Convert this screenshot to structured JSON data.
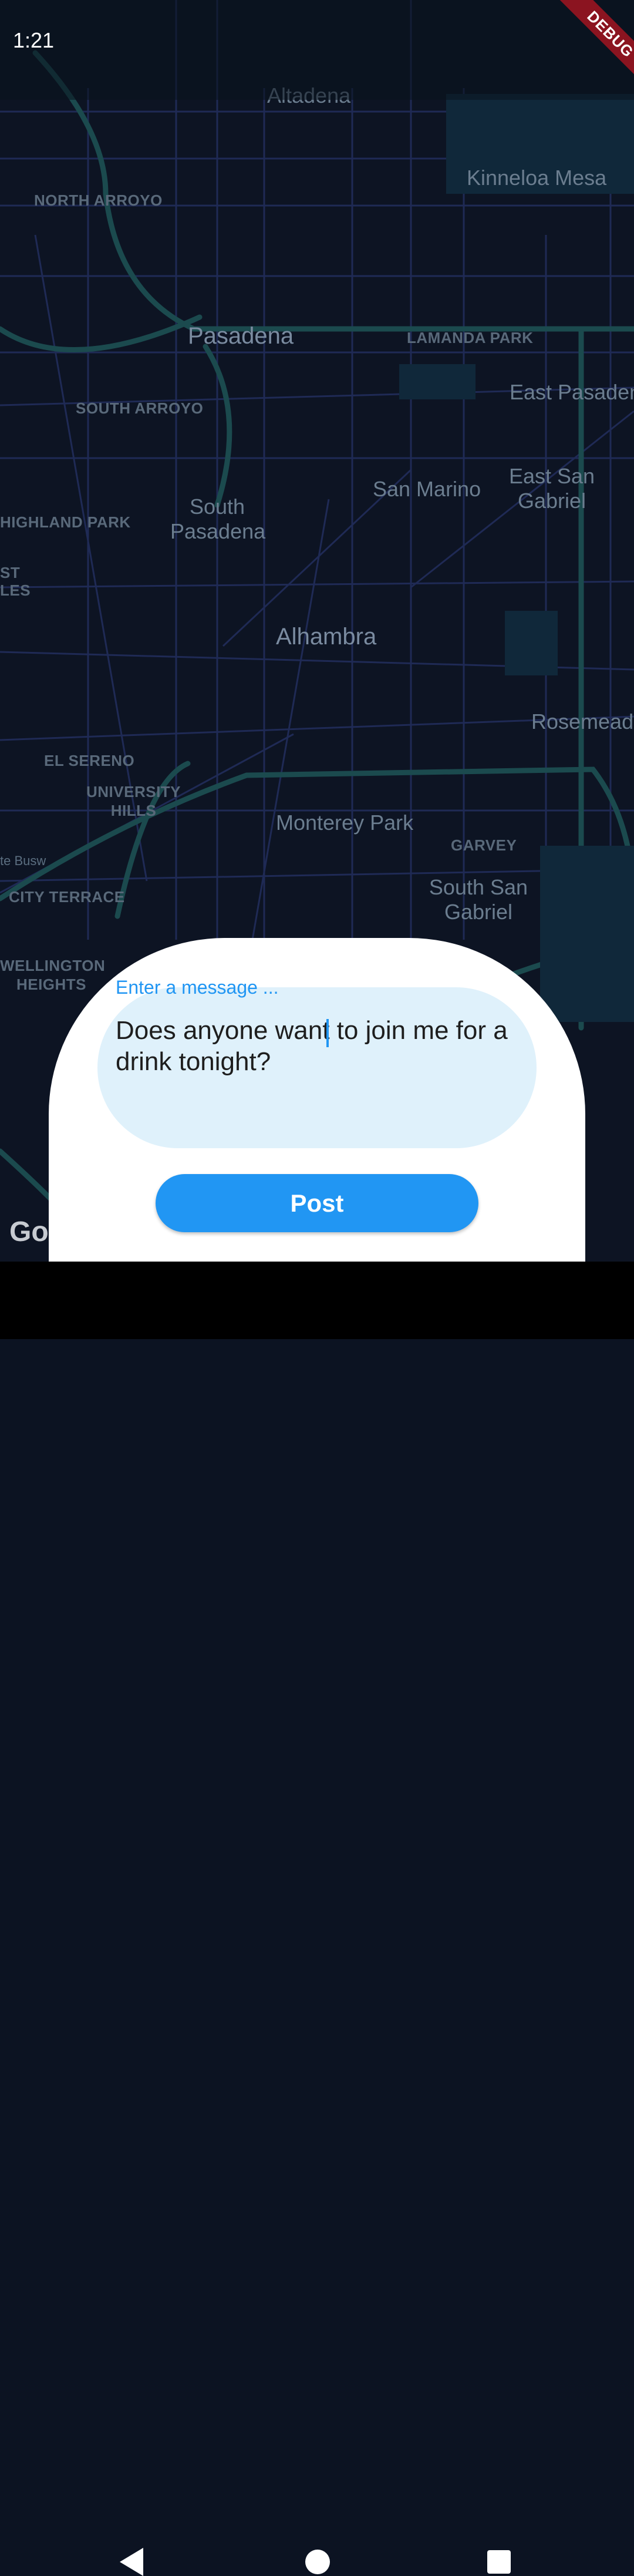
{
  "status_bar": {
    "time": "1:21"
  },
  "debug_banner": "DEBUG",
  "map": {
    "labels": {
      "altadena": "Altadena",
      "kinneloa_mesa": "Kinneloa Mesa",
      "north_arroyo": "NORTH ARROYO",
      "pasadena": "Pasadena",
      "lamanda_park": "LAMANDA PARK",
      "east_pasadena": "East Pasaden",
      "south_arroyo": "SOUTH ARROYO",
      "south_pasadena_1": "South",
      "south_pasadena_2": "Pasadena",
      "san_marino": "San Marino",
      "east_san_gabriel_1": "East San",
      "east_san_gabriel_2": "Gabriel",
      "highland_park": "HIGHLAND PARK",
      "east_la_1": "ST",
      "east_la_2": "LES",
      "alhambra": "Alhambra",
      "rosemead": "Rosemead",
      "el_sereno": "EL SERENO",
      "university_hills_1": "UNIVERSITY",
      "university_hills_2": "HILLS",
      "monterey_park": "Monterey Park",
      "garvey": "GARVEY",
      "busway": "te Busw",
      "city_terrace": "CITY TERRACE",
      "south_san_gabriel_1": "South San",
      "south_san_gabriel_2": "Gabriel",
      "wellington_heights_1": "WELLINGTON",
      "wellington_heights_2": "HEIGHTS"
    },
    "google_logo": "Go"
  },
  "compose": {
    "field_label": "Enter a message ...",
    "message_value": "Does anyone want to join me for a drink tonight?",
    "post_label": "Post"
  },
  "nav_bar": {
    "back_icon": "triangle-back-icon",
    "home_icon": "circle-home-icon",
    "recent_icon": "square-recents-icon"
  }
}
